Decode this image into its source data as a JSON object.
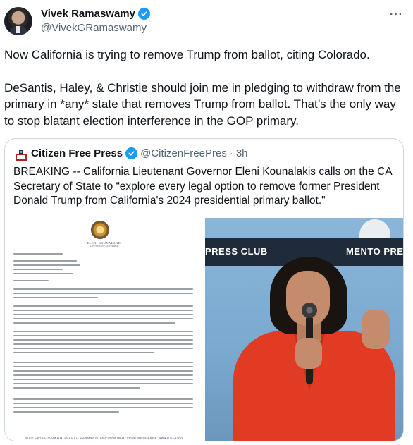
{
  "author": {
    "name": "Vivek Ramaswamy",
    "handle": "@VivekGRamaswamy"
  },
  "more_icon": "more-icon",
  "tweet_paragraphs": [
    "Now California is trying to remove Trump from ballot, citing Colorado.",
    "DeSantis, Haley, & Christie should join me in pledging to withdraw from the primary in *any* state that removes Trump from ballot. That’s the only way to stop blatant election interference in the GOP primary."
  ],
  "quote": {
    "name": "Citizen Free Press",
    "handle": "@CitizenFreePres",
    "dot": "·",
    "time": "3h",
    "text": "BREAKING -- California Lieutenant Governor Eleni Kounalakis calls on the CA Secretary of State to “explore every legal option to remove former President Donald Trump from California's 2024 presidential primary ballot.\""
  },
  "document": {
    "officer_name": "ELENI KOUNALAKIS",
    "officer_title": "LIEUTENANT GOVERNOR",
    "footer": "STATE CAPITOL, ROOM 1114, 1021 O ST., SACRAMENTO, CALIFORNIA 95814 · PHONE (916) 445-8994 · WWW.LTG.CA.GOV"
  },
  "photo": {
    "banner_left": "PRESS CLUB",
    "banner_right": "MENTO PRESS C"
  },
  "colors": {
    "verified": "#1d9bf0",
    "secondary_text": "#536471",
    "border": "#cfd9de",
    "jacket": "#e23b24"
  }
}
